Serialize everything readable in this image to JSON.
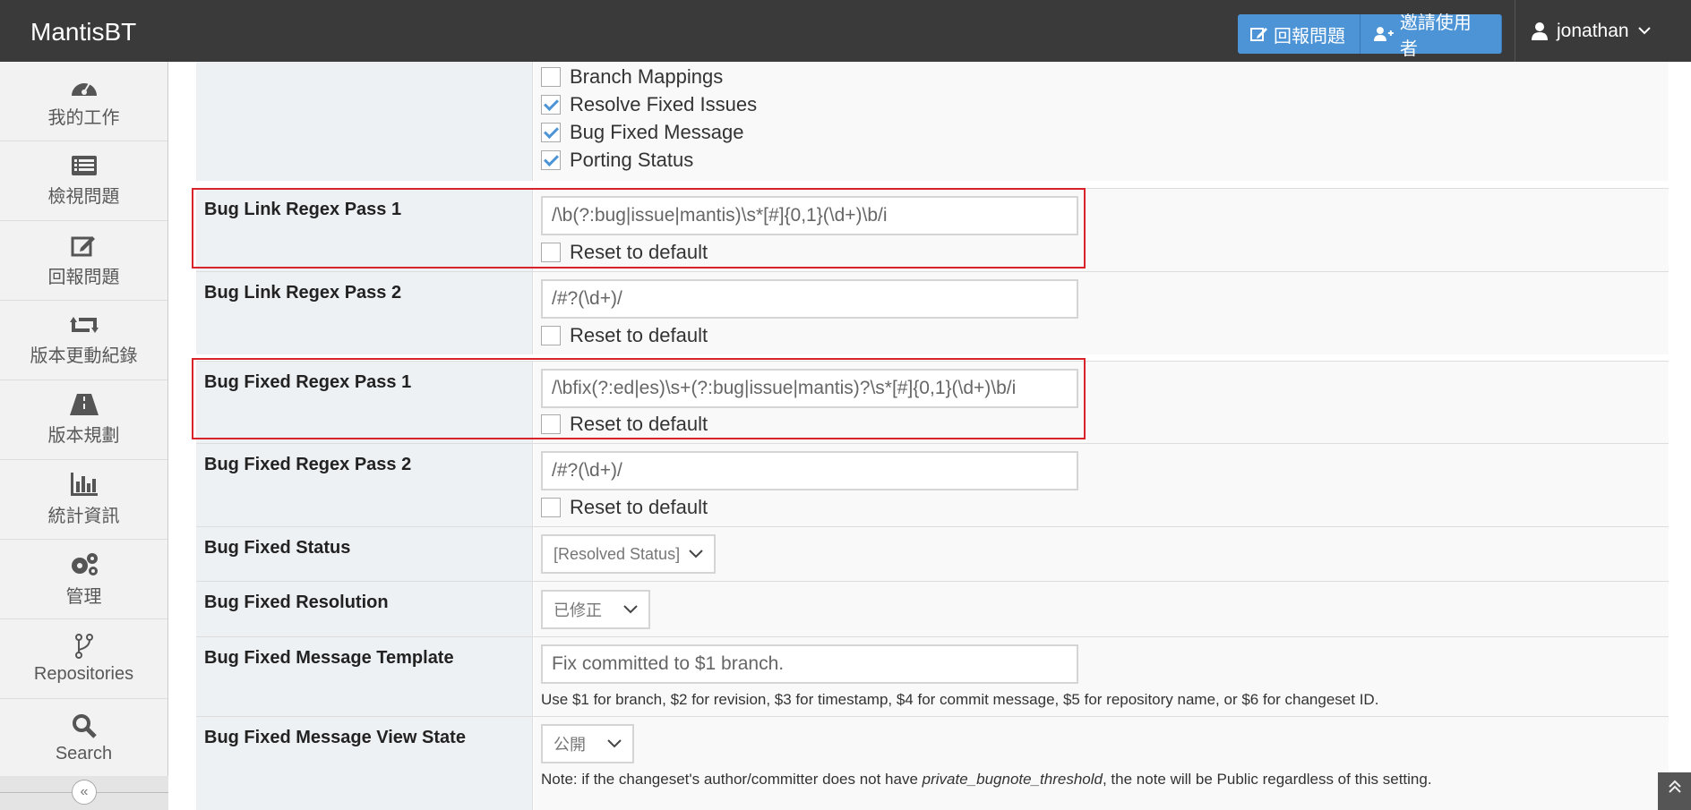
{
  "app": {
    "brand": "MantisBT"
  },
  "navbar": {
    "report_issue": "回報問題",
    "invite_user": "邀請使用者",
    "username": "jonathan"
  },
  "sidebar": {
    "items": [
      {
        "label": "我的工作",
        "icon": "dashboard-icon"
      },
      {
        "label": "檢視問題",
        "icon": "list-icon"
      },
      {
        "label": "回報問題",
        "icon": "edit-icon"
      },
      {
        "label": "版本更動紀錄",
        "icon": "retweet-icon"
      },
      {
        "label": "版本規劃",
        "icon": "road-icon"
      },
      {
        "label": "統計資訊",
        "icon": "bar-chart-icon"
      },
      {
        "label": "管理",
        "icon": "gears-icon"
      },
      {
        "label": "Repositories",
        "icon": "code-fork-icon"
      },
      {
        "label": "Search",
        "icon": "search-icon"
      }
    ]
  },
  "features": {
    "items": [
      {
        "label": "Branch Mappings",
        "checked": false
      },
      {
        "label": "Resolve Fixed Issues",
        "checked": true
      },
      {
        "label": "Bug Fixed Message",
        "checked": true
      },
      {
        "label": "Porting Status",
        "checked": true
      }
    ]
  },
  "settings": {
    "reset_label": "Reset to default",
    "bug_link_pass1": {
      "label": "Bug Link Regex Pass 1",
      "value": "/\\b(?:bug|issue|mantis)\\s*[#]{0,1}(\\d+)\\b/i"
    },
    "bug_link_pass2": {
      "label": "Bug Link Regex Pass 2",
      "value": "/#?(\\d+)/"
    },
    "bug_fixed_pass1": {
      "label": "Bug Fixed Regex Pass 1",
      "value": "/\\bfix(?:ed|es)\\s+(?:bug|issue|mantis)?\\s*[#]{0,1}(\\d+)\\b/i"
    },
    "bug_fixed_pass2": {
      "label": "Bug Fixed Regex Pass 2",
      "value": "/#?(\\d+)/"
    },
    "bug_fixed_status": {
      "label": "Bug Fixed Status",
      "value": "[Resolved Status]"
    },
    "bug_fixed_resolution": {
      "label": "Bug Fixed Resolution",
      "value": "已修正"
    },
    "bug_fixed_template": {
      "label": "Bug Fixed Message Template",
      "value": "Fix committed to $1 branch.",
      "help": "Use $1 for branch, $2 for revision, $3 for timestamp, $4 for commit message, $5 for repository name, or $6 for changeset ID."
    },
    "bug_fixed_view_state": {
      "label": "Bug Fixed Message View State",
      "value": "公開",
      "help_pre": "Note: if the changeset's author/committer does not have ",
      "help_em": "private_bugnote_threshold",
      "help_post": ", the note will be Public regardless of this setting."
    }
  },
  "colors": {
    "navbar": "#3a3a3a",
    "accent": "#4c94d6",
    "highlight": "#d9232a"
  }
}
